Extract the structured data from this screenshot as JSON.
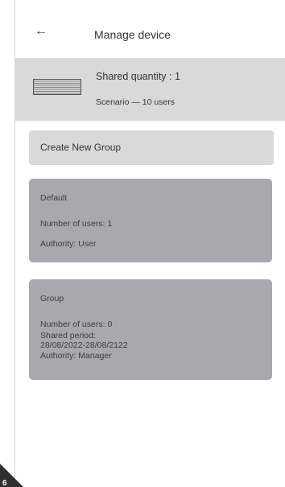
{
  "header": {
    "back_glyph": "←",
    "title": "Manage device"
  },
  "device": {
    "icon": "gate-device-icon",
    "shared_quantity": "Shared quantity : 1",
    "scenario": "Scenario — 10 users"
  },
  "create_group": {
    "label": "Create New Group"
  },
  "groups": [
    {
      "name": "Default",
      "users": "Number of users: 1",
      "authority": "Authority: User"
    },
    {
      "name": "Group",
      "users": "Number of users: 0",
      "shared_period_label": "Shared period:",
      "shared_period_value": "28/08/2022-28/08/2122",
      "authority": "Authority: Manager"
    }
  ],
  "page_badge": "6",
  "colors": {
    "device_bar": "#d9d9d9",
    "card": "#a9a9ad",
    "badge": "#303030"
  }
}
